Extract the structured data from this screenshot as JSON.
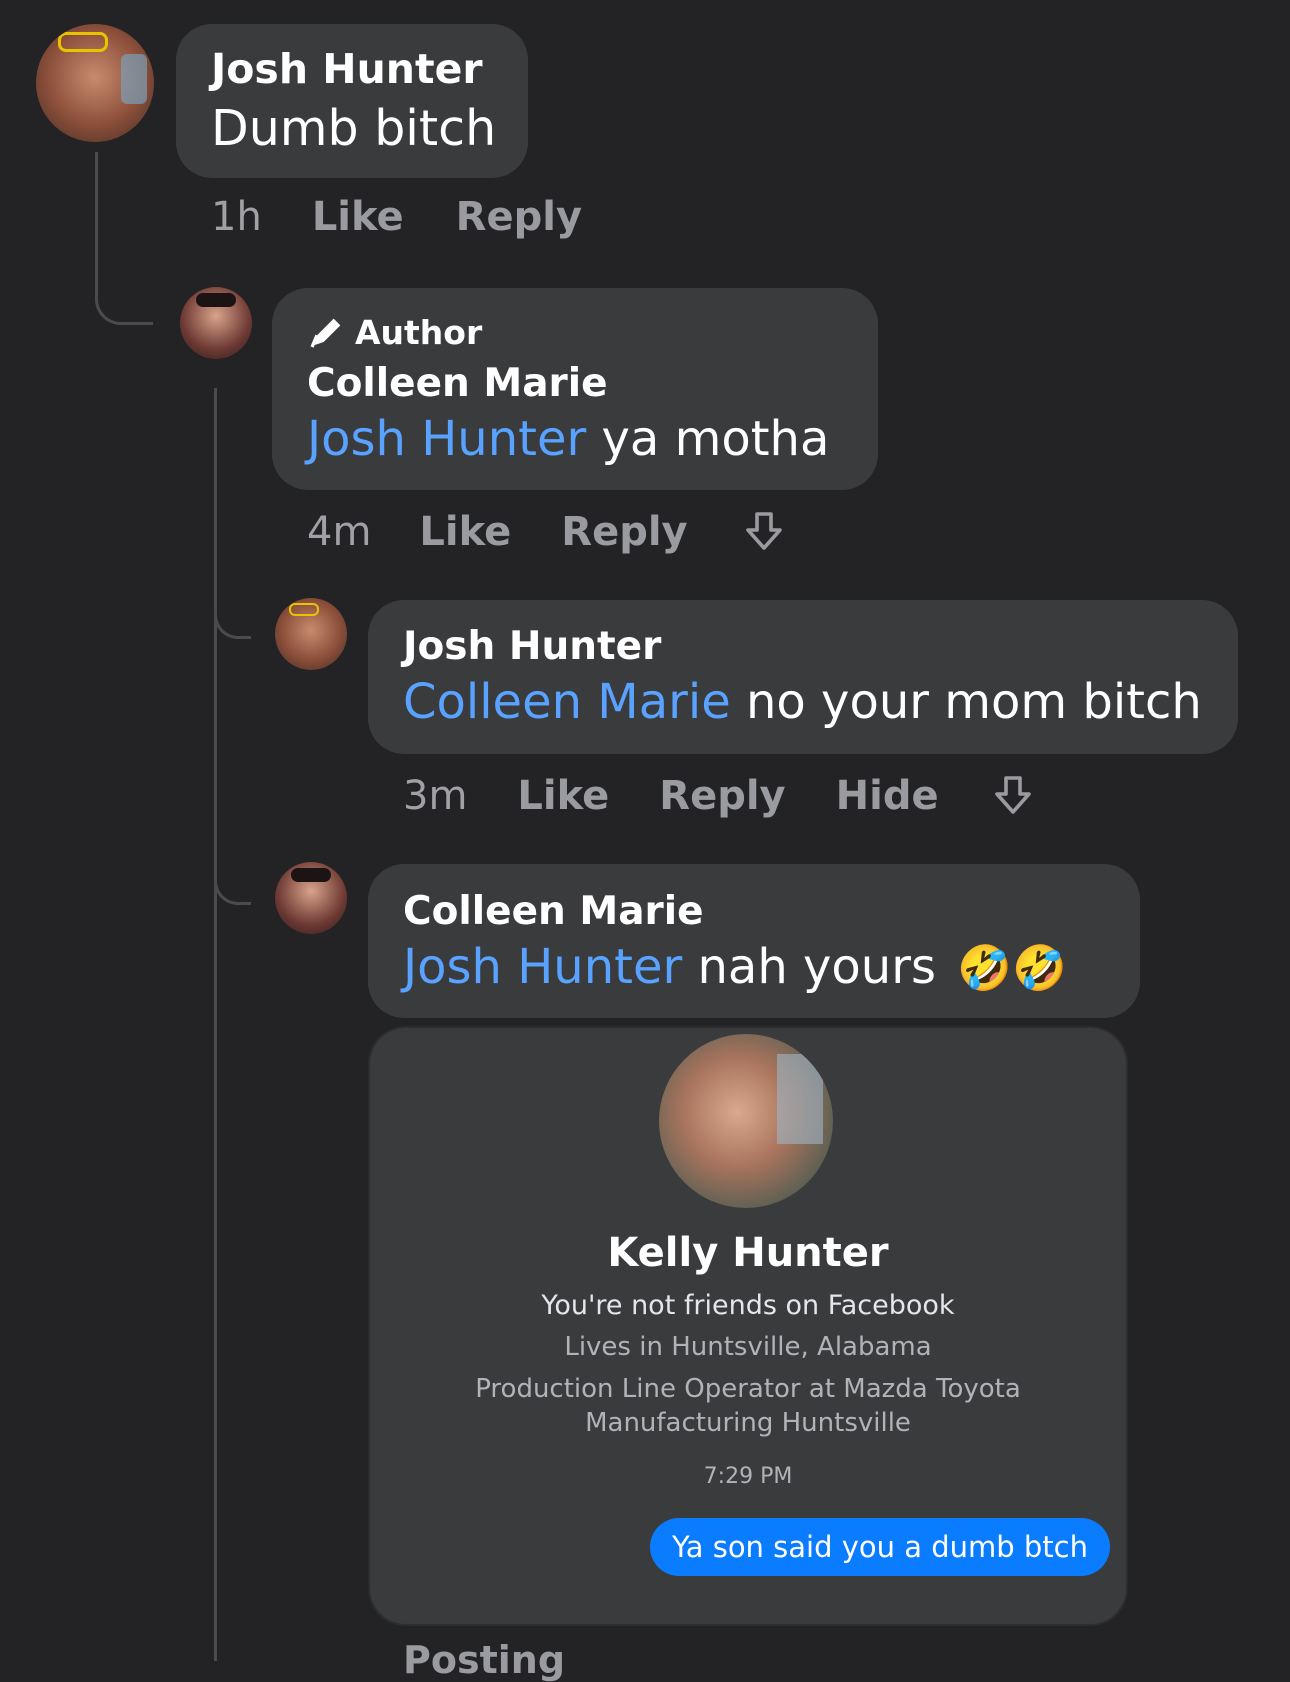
{
  "comments": [
    {
      "name": "Josh Hunter",
      "text": "Dumb bitch",
      "time": "1h",
      "like": "Like",
      "reply": "Reply"
    },
    {
      "badge": "Author",
      "name": "Colleen Marie",
      "mention": "Josh Hunter",
      "text": "ya motha",
      "time": "4m",
      "like": "Like",
      "reply": "Reply"
    },
    {
      "name": "Josh Hunter",
      "mention": "Colleen Marie",
      "text": "no your mom bitch",
      "time": "3m",
      "like": "Like",
      "reply": "Reply",
      "hide": "Hide"
    },
    {
      "name": "Colleen Marie",
      "mention": "Josh Hunter",
      "text": "nah yours",
      "emoji": "🤣🤣"
    }
  ],
  "attachment": {
    "profile_name": "Kelly Hunter",
    "relationship": "You're not friends on Facebook",
    "location": "Lives in Huntsville, Alabama",
    "work_line1": "Production Line Operator at Mazda Toyota",
    "work_line2": "Manufacturing Huntsville",
    "timestamp": "7:29 PM",
    "sent_message": "Ya son said you a dumb btch"
  },
  "footer_text": "Posting",
  "colors": {
    "background": "#232325",
    "bubble": "#3a3b3d",
    "mention": "#5aa2ff",
    "sent": "#0a7cff"
  }
}
